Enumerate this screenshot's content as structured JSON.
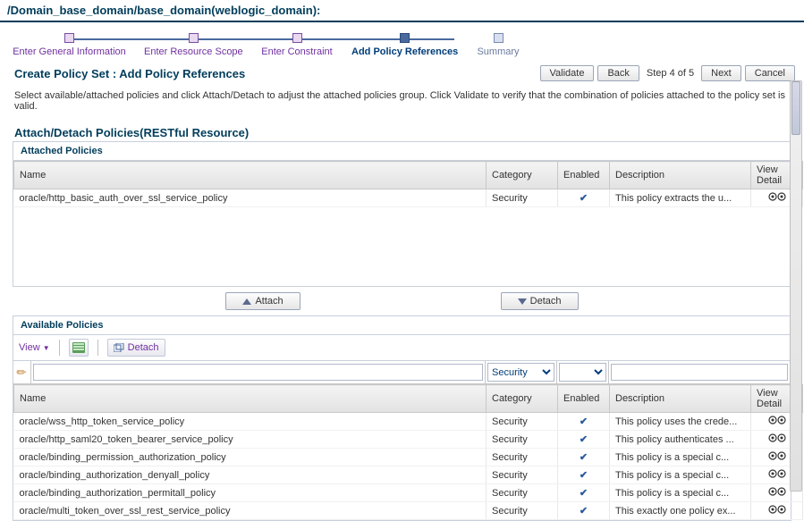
{
  "breadcrumb": "/Domain_base_domain/base_domain(weblogic_domain):",
  "wizard": {
    "steps": [
      {
        "label": "Enter General Information",
        "state": "past"
      },
      {
        "label": "Enter Resource Scope",
        "state": "past"
      },
      {
        "label": "Enter Constraint",
        "state": "past"
      },
      {
        "label": "Add Policy References",
        "state": "active"
      },
      {
        "label": "Summary",
        "state": "future"
      }
    ]
  },
  "page_title": "Create Policy Set : Add Policy References",
  "actions": {
    "validate": "Validate",
    "back": "Back",
    "step_info": "Step 4 of 5",
    "next": "Next",
    "cancel": "Cancel"
  },
  "description": "Select available/attached policies and click Attach/Detach to adjust the attached policies group. Click Validate to verify that the combination of policies attached to the policy set is valid.",
  "section_title": "Attach/Detach Policies(RESTful Resource)",
  "attached": {
    "header": "Attached Policies",
    "columns": {
      "name": "Name",
      "category": "Category",
      "enabled": "Enabled",
      "description": "Description",
      "view": "View Detail"
    },
    "rows": [
      {
        "name": "oracle/http_basic_auth_over_ssl_service_policy",
        "category": "Security",
        "enabled": true,
        "description": "This policy extracts the u..."
      }
    ]
  },
  "attach_btn": "Attach",
  "detach_btn": "Detach",
  "available": {
    "header": "Available Policies",
    "view_label": "View",
    "detach_label": "Detach",
    "filter_category": "Security",
    "columns": {
      "name": "Name",
      "category": "Category",
      "enabled": "Enabled",
      "description": "Description",
      "view": "View Detail"
    },
    "rows": [
      {
        "name": "oracle/wss_http_token_service_policy",
        "category": "Security",
        "enabled": true,
        "description": "This policy uses the crede..."
      },
      {
        "name": "oracle/http_saml20_token_bearer_service_policy",
        "category": "Security",
        "enabled": true,
        "description": "This policy authenticates ..."
      },
      {
        "name": "oracle/binding_permission_authorization_policy",
        "category": "Security",
        "enabled": true,
        "description": "This policy is a special c..."
      },
      {
        "name": "oracle/binding_authorization_denyall_policy",
        "category": "Security",
        "enabled": true,
        "description": "This policy is a special c..."
      },
      {
        "name": "oracle/binding_authorization_permitall_policy",
        "category": "Security",
        "enabled": true,
        "description": "This policy is a special c..."
      },
      {
        "name": "oracle/multi_token_over_ssl_rest_service_policy",
        "category": "Security",
        "enabled": true,
        "description": "This exactly one policy ex..."
      }
    ]
  }
}
